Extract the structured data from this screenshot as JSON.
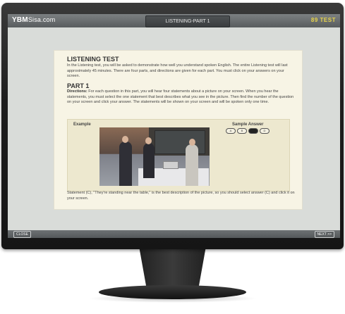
{
  "app": {
    "logo_main": "YBM",
    "logo_sub": "Sisa.com",
    "window_title": "LISTENING-PART 1",
    "brand": "89 TEST"
  },
  "page": {
    "heading": "LISTENING TEST",
    "intro": "In the Listening test, you will be asked to demonstrate how well you understand spoken English. The entire Listening test will last approximately 45 minutes. There are four parts, and directions are given for each part. You must click on your answers on your screen.",
    "part_heading": "PART 1",
    "directions_label": "Directions:",
    "directions_text": " For each question in this part, you will hear four statements about a picture on your screen. When you hear the statements, you must select the one statement that best describes what you see in the picture. Then find the number of the question on your screen and click your answer. The statements will be shown on your screen and will be spoken only one time.",
    "example_label": "Example",
    "sample_answer_label": "Sample Answer",
    "answer_options": [
      "A",
      "B",
      "C",
      "D"
    ],
    "selected_answer": "C",
    "statement": "Statement (C), \"They're standing near the table,\" is the best description of the picture, so you should select answer (C) and click it on your screen."
  },
  "footer": {
    "close_label": "CLOSE",
    "next_label": "NEXT >>"
  }
}
